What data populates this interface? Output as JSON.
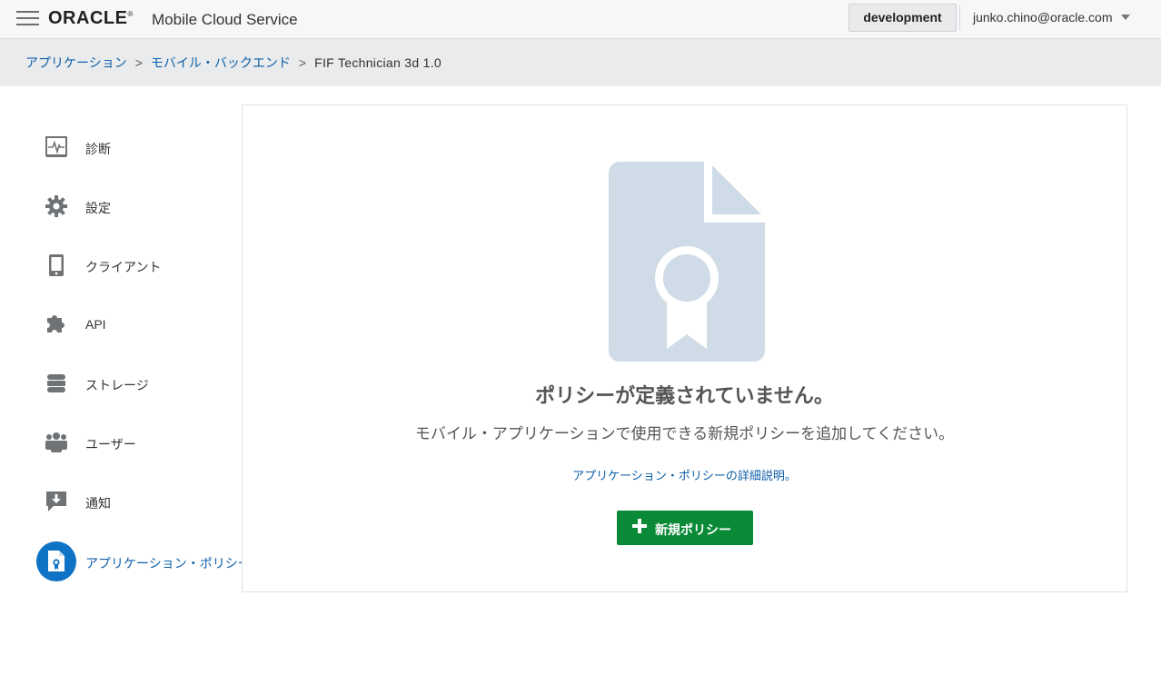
{
  "header": {
    "logo_text": "ORACLE",
    "logo_mark": "®",
    "product_name": "Mobile Cloud Service",
    "environment_button": "development",
    "user_email": "junko.chino@oracle.com"
  },
  "breadcrumb": {
    "items": [
      "アプリケーション",
      "モバイル・バックエンド"
    ],
    "separator": ">",
    "current": "FIF Technician 3d 1.0"
  },
  "sidebar": {
    "items": [
      {
        "label": "診断",
        "icon": "diagnostics-icon"
      },
      {
        "label": "設定",
        "icon": "gear-icon"
      },
      {
        "label": "クライアント",
        "icon": "mobile-device-icon"
      },
      {
        "label": "API",
        "icon": "puzzle-icon"
      },
      {
        "label": "ストレージ",
        "icon": "storage-icon"
      },
      {
        "label": "ユーザー",
        "icon": "users-icon"
      },
      {
        "label": "通知",
        "icon": "notification-icon"
      },
      {
        "label": "アプリケーション・ポリシー",
        "icon": "policy-document-icon",
        "active": true
      }
    ]
  },
  "main": {
    "empty_title": "ポリシーが定義されていません。",
    "empty_description": "モバイル・アプリケーションで使用できる新規ポリシーを追加してください。",
    "learn_more_link": "アプリケーション・ポリシーの詳細説明。",
    "new_policy_button": "新規ポリシー",
    "illustration_icon": "policy-certificate-document-icon"
  },
  "colors": {
    "accent": "#0f73c5",
    "link": "#0d5fa9",
    "primary_button": "#0a8a37",
    "illustration": "#cfdbe6"
  }
}
